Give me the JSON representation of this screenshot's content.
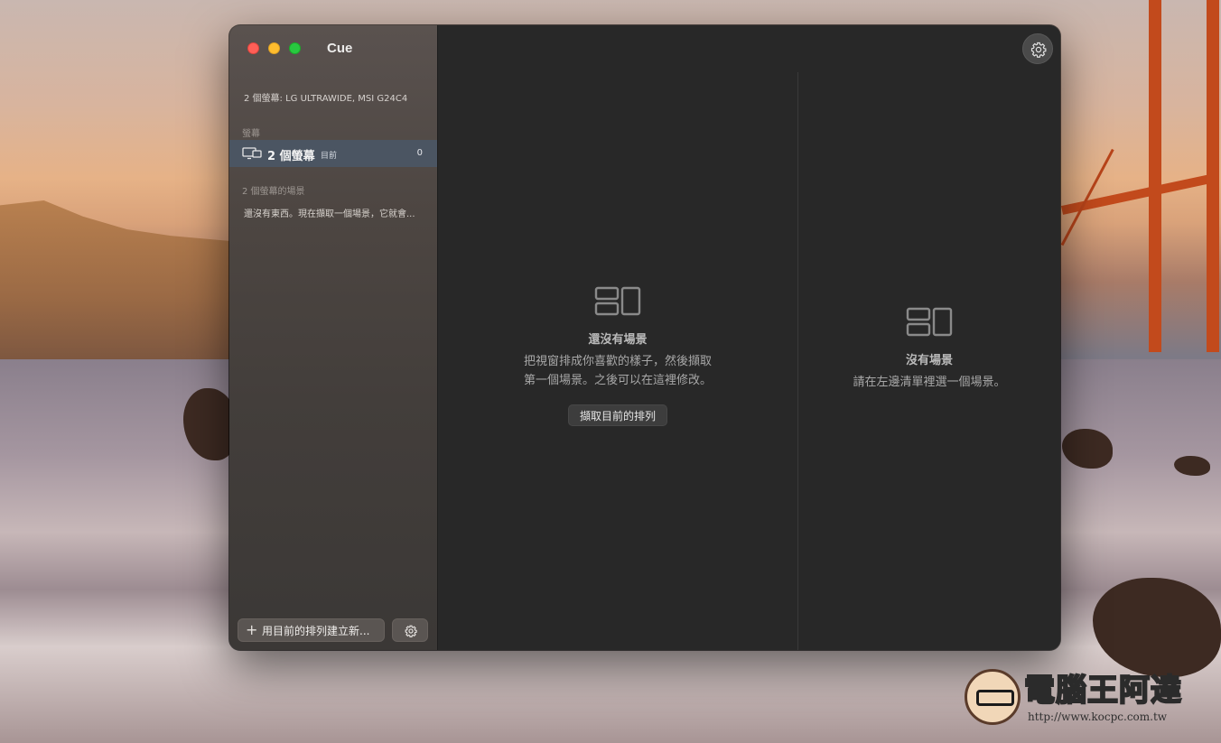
{
  "window": {
    "title": "Cue",
    "settings_icon": "gear-icon"
  },
  "sidebar": {
    "displays_summary": "2 個螢幕: LG ULTRAWIDE, MSI G24C4",
    "screens_section_label": "螢幕",
    "screen_item": {
      "icon": "displays-icon",
      "label": "2 個螢幕",
      "badge": "目前",
      "count": "0"
    },
    "scenes_section_label": "2 個螢幕的場景",
    "scenes_empty_message": "還沒有東西。現在擷取一個場景，它就會...",
    "new_scene_button": "用目前的排列建立新...",
    "new_scene_icon": "plus-icon",
    "sidebar_settings_icon": "gear-icon"
  },
  "main": {
    "left_pane": {
      "icon": "layout-icon",
      "heading": "還沒有場景",
      "description_line1": "把視窗排成你喜歡的樣子，然後擷取",
      "description_line2": "第一個場景。之後可以在這裡修改。",
      "capture_button": "擷取目前的排列"
    },
    "right_pane": {
      "icon": "layout-icon",
      "heading": "沒有場景",
      "description": "請在左邊清單裡選一個場景。"
    }
  },
  "watermark": {
    "text": "電腦王阿達",
    "url": "http://www.kocpc.com.tw"
  },
  "colors": {
    "close": "#ff5f57",
    "minimize": "#febc2e",
    "maximize": "#28c840",
    "selected_row": "#4b5562"
  }
}
